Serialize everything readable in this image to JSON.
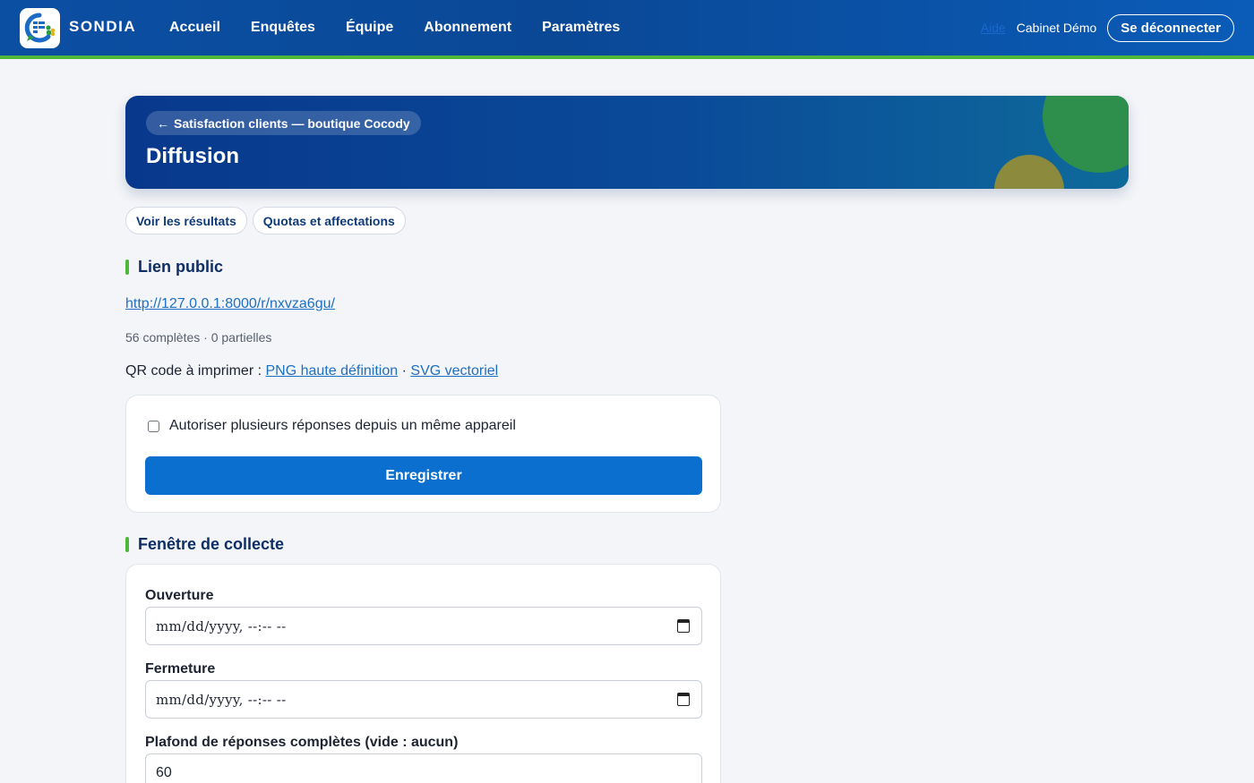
{
  "navbar": {
    "brand": "SONDIA",
    "items": [
      {
        "label": "Accueil"
      },
      {
        "label": "Enquêtes"
      },
      {
        "label": "Équipe"
      },
      {
        "label": "Abonnement"
      },
      {
        "label": "Paramètres"
      }
    ],
    "help_label": "Aide",
    "org_name": "Cabinet Démo",
    "logout_label": "Se déconnecter"
  },
  "hero": {
    "back_label": "Satisfaction clients — boutique Cocody",
    "title": "Diffusion"
  },
  "subtabs": [
    {
      "label": "Voir les résultats"
    },
    {
      "label": "Quotas et affectations"
    }
  ],
  "public_link": {
    "title": "Lien public",
    "url": "http://127.0.0.1:8000/r/nxvza6gu/",
    "counts": "56 complètes · 0 partielles",
    "qr_prefix": "QR code à imprimer :",
    "qr_png": "PNG haute définition",
    "qr_sep": "·",
    "qr_svg": "SVG vectoriel",
    "allow_multiple_label": "Autoriser plusieurs réponses depuis un même appareil",
    "allow_multiple_checked": false,
    "save_label": "Enregistrer"
  },
  "window": {
    "title": "Fenêtre de collecte",
    "opening_label": "Ouverture",
    "opening_placeholder": "mm/dd/yyyy, --:-- --",
    "closing_label": "Fermeture",
    "closing_placeholder": "mm/dd/yyyy, --:-- --",
    "cap_label": "Plafond de réponses complètes (vide : aucun)",
    "cap_value": "60"
  },
  "colors": {
    "nav_bg": "#0b4fa3",
    "accent_green": "#4fb83b",
    "primary_button": "#0b6fd0",
    "link": "#1f6fc2"
  }
}
